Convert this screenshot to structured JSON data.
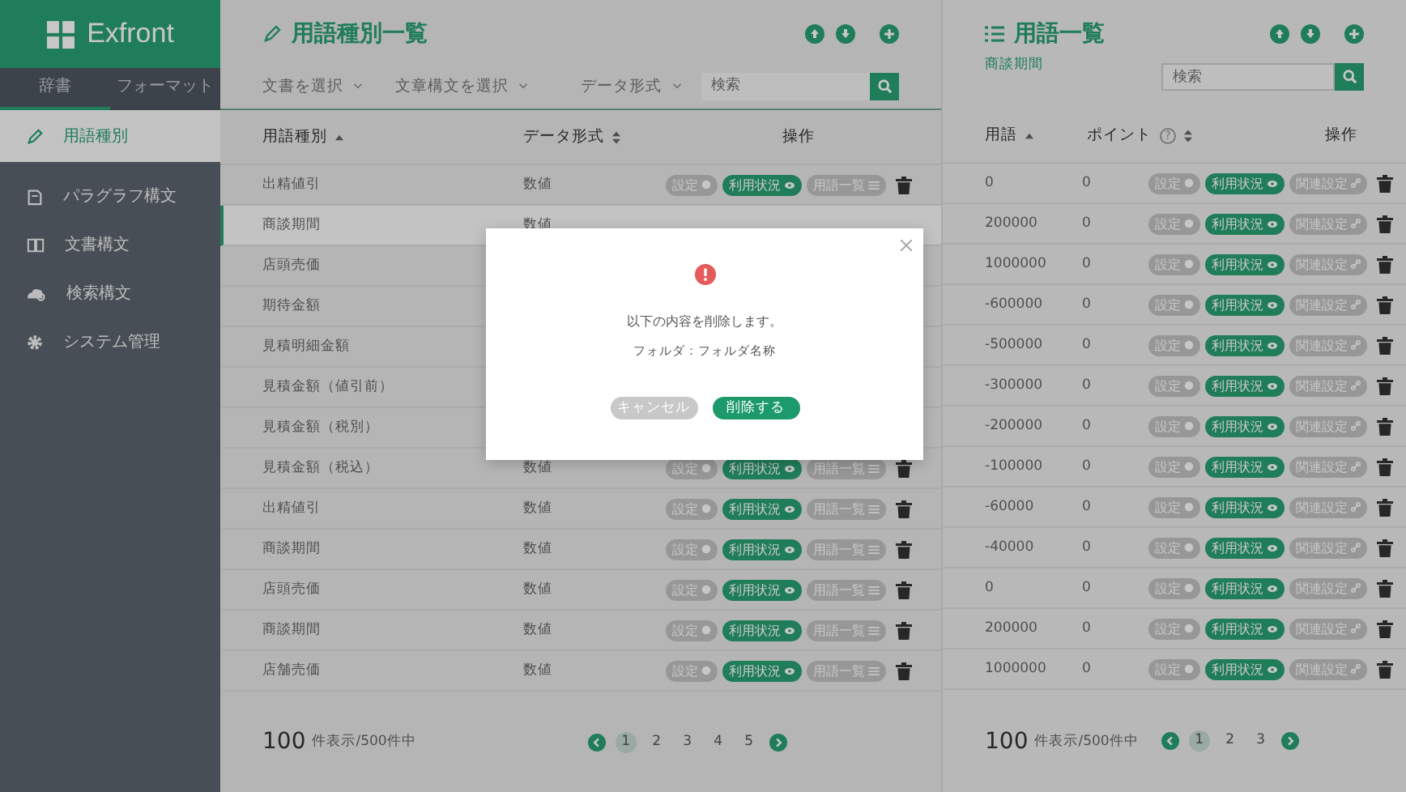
{
  "sidebar": {
    "logo": "Exfront",
    "tabs": [
      {
        "label": "辞書",
        "selected": true
      },
      {
        "label": "フォーマット",
        "selected": false
      }
    ],
    "items": [
      {
        "label": "用語種別",
        "selected": true
      },
      {
        "label": "パラグラフ構文",
        "selected": false
      },
      {
        "label": "文書構文",
        "selected": false
      },
      {
        "label": "検索構文",
        "selected": false
      },
      {
        "label": "システム管理",
        "selected": false
      }
    ]
  },
  "left_panel": {
    "title": "用語種別一覧",
    "filters": [
      "文書を選択",
      "文章構文を選択",
      "データ形式"
    ],
    "search": {
      "placeholder": "検索"
    },
    "columns": [
      {
        "label": "用語種別",
        "kind": "sort-asc"
      },
      {
        "label": "データ形式",
        "kind": "sort-both"
      },
      {
        "label": "操作",
        "kind": "plain"
      }
    ],
    "rows": [
      {
        "name": "出精値引",
        "format": "数値",
        "selected": false,
        "actions": [
          {
            "label": "設定",
            "kind": "settings"
          },
          {
            "label": "利用状況",
            "kind": "usage"
          },
          {
            "label": "用語一覧",
            "kind": "list"
          }
        ]
      },
      {
        "name": "商談期間",
        "format": "数値",
        "selected": true
      },
      {
        "name": "店頭売価",
        "selected": false
      },
      {
        "name": "期待金額",
        "selected": false
      },
      {
        "name": "見積明細金額",
        "selected": false
      },
      {
        "name": "見積金額（値引前）",
        "selected": false
      },
      {
        "name": "見積金額（税別）",
        "selected": false
      },
      {
        "name": "見積金額（税込）",
        "format": "数値",
        "selected": false,
        "actions": [
          {
            "label": "設定",
            "kind": "settings"
          },
          {
            "label": "利用状況",
            "kind": "usage"
          },
          {
            "label": "用語一覧",
            "kind": "list"
          }
        ]
      },
      {
        "name": "出精値引",
        "format": "数値",
        "selected": false,
        "actions": [
          {
            "label": "設定",
            "kind": "settings"
          },
          {
            "label": "利用状況",
            "kind": "usage"
          },
          {
            "label": "用語一覧",
            "kind": "list"
          }
        ]
      },
      {
        "name": "商談期間",
        "format": "数値",
        "selected": false,
        "actions": [
          {
            "label": "設定",
            "kind": "settings"
          },
          {
            "label": "利用状況",
            "kind": "usage"
          },
          {
            "label": "用語一覧",
            "kind": "list"
          }
        ]
      },
      {
        "name": "店頭売価",
        "format": "数値",
        "selected": false,
        "actions": [
          {
            "label": "設定",
            "kind": "settings"
          },
          {
            "label": "利用状況",
            "kind": "usage"
          },
          {
            "label": "用語一覧",
            "kind": "list"
          }
        ]
      },
      {
        "name": "商談期間",
        "format": "数値",
        "selected": false,
        "actions": [
          {
            "label": "設定",
            "kind": "settings"
          },
          {
            "label": "利用状況",
            "kind": "usage"
          },
          {
            "label": "用語一覧",
            "kind": "list"
          }
        ]
      },
      {
        "name": "店舗売価",
        "format": "数値",
        "selected": false,
        "actions": [
          {
            "label": "設定",
            "kind": "settings"
          },
          {
            "label": "利用状況",
            "kind": "usage"
          },
          {
            "label": "用語一覧",
            "kind": "list"
          }
        ]
      }
    ],
    "pager": {
      "count": "100",
      "count_label": "件表示/500件中",
      "pages": [
        {
          "label": "1",
          "selected": true
        },
        {
          "label": "2",
          "selected": false
        },
        {
          "label": "3",
          "selected": false
        },
        {
          "label": "4",
          "selected": false
        },
        {
          "label": "5",
          "selected": false
        }
      ]
    }
  },
  "right_panel": {
    "title": "用語一覧",
    "subtitle": "商談期間",
    "search": {
      "placeholder": "検索"
    },
    "columns": [
      {
        "label": "用語",
        "kind": "sort-asc"
      },
      {
        "label": "ポイント",
        "kind": "sort-both",
        "help": "?"
      },
      {
        "label": "操作",
        "kind": "plain"
      }
    ],
    "rows": [
      {
        "term": "0",
        "point": "0",
        "actions": [
          {
            "label": "設定",
            "kind": "settings"
          },
          {
            "label": "利用状況",
            "kind": "usage"
          },
          {
            "label": "関連設定",
            "kind": "link"
          }
        ]
      },
      {
        "term": "200000",
        "point": "0",
        "actions": [
          {
            "label": "設定",
            "kind": "settings"
          },
          {
            "label": "利用状況",
            "kind": "usage"
          },
          {
            "label": "関連設定",
            "kind": "link"
          }
        ]
      },
      {
        "term": "1000000",
        "point": "0",
        "actions": [
          {
            "label": "設定",
            "kind": "settings"
          },
          {
            "label": "利用状況",
            "kind": "usage"
          },
          {
            "label": "関連設定",
            "kind": "link"
          }
        ]
      },
      {
        "term": "-600000",
        "point": "0",
        "actions": [
          {
            "label": "設定",
            "kind": "settings"
          },
          {
            "label": "利用状況",
            "kind": "usage"
          },
          {
            "label": "関連設定",
            "kind": "link"
          }
        ]
      },
      {
        "term": "-500000",
        "point": "0",
        "actions": [
          {
            "label": "設定",
            "kind": "settings"
          },
          {
            "label": "利用状況",
            "kind": "usage"
          },
          {
            "label": "関連設定",
            "kind": "link"
          }
        ]
      },
      {
        "term": "-300000",
        "point": "0",
        "actions": [
          {
            "label": "設定",
            "kind": "settings"
          },
          {
            "label": "利用状況",
            "kind": "usage"
          },
          {
            "label": "関連設定",
            "kind": "link"
          }
        ]
      },
      {
        "term": "-200000",
        "point": "0",
        "actions": [
          {
            "label": "設定",
            "kind": "settings"
          },
          {
            "label": "利用状況",
            "kind": "usage"
          },
          {
            "label": "関連設定",
            "kind": "link"
          }
        ]
      },
      {
        "term": "-100000",
        "point": "0",
        "actions": [
          {
            "label": "設定",
            "kind": "settings"
          },
          {
            "label": "利用状況",
            "kind": "usage"
          },
          {
            "label": "関連設定",
            "kind": "link"
          }
        ]
      },
      {
        "term": "-60000",
        "point": "0",
        "actions": [
          {
            "label": "設定",
            "kind": "settings"
          },
          {
            "label": "利用状況",
            "kind": "usage"
          },
          {
            "label": "関連設定",
            "kind": "link"
          }
        ]
      },
      {
        "term": "-40000",
        "point": "0",
        "actions": [
          {
            "label": "設定",
            "kind": "settings"
          },
          {
            "label": "利用状況",
            "kind": "usage"
          },
          {
            "label": "関連設定",
            "kind": "link"
          }
        ]
      },
      {
        "term": "0",
        "point": "0",
        "actions": [
          {
            "label": "設定",
            "kind": "settings"
          },
          {
            "label": "利用状況",
            "kind": "usage"
          },
          {
            "label": "関連設定",
            "kind": "link"
          }
        ]
      },
      {
        "term": "200000",
        "point": "0",
        "actions": [
          {
            "label": "設定",
            "kind": "settings"
          },
          {
            "label": "利用状況",
            "kind": "usage"
          },
          {
            "label": "関連設定",
            "kind": "link"
          }
        ]
      },
      {
        "term": "1000000",
        "point": "0",
        "actions": [
          {
            "label": "設定",
            "kind": "settings"
          },
          {
            "label": "利用状況",
            "kind": "usage"
          },
          {
            "label": "関連設定",
            "kind": "link"
          }
        ]
      }
    ],
    "pager": {
      "count": "100",
      "count_label": "件表示/500件中",
      "pages": [
        {
          "label": "1",
          "selected": true
        },
        {
          "label": "2",
          "selected": false
        },
        {
          "label": "3",
          "selected": false
        }
      ]
    }
  },
  "dialog": {
    "message": "以下の内容を削除します。",
    "detail": "フォルダ：フォルダ名称",
    "buttons": [
      {
        "label": "キャンセル",
        "kind": "cancel"
      },
      {
        "label": "削除する",
        "kind": "confirm"
      }
    ]
  }
}
